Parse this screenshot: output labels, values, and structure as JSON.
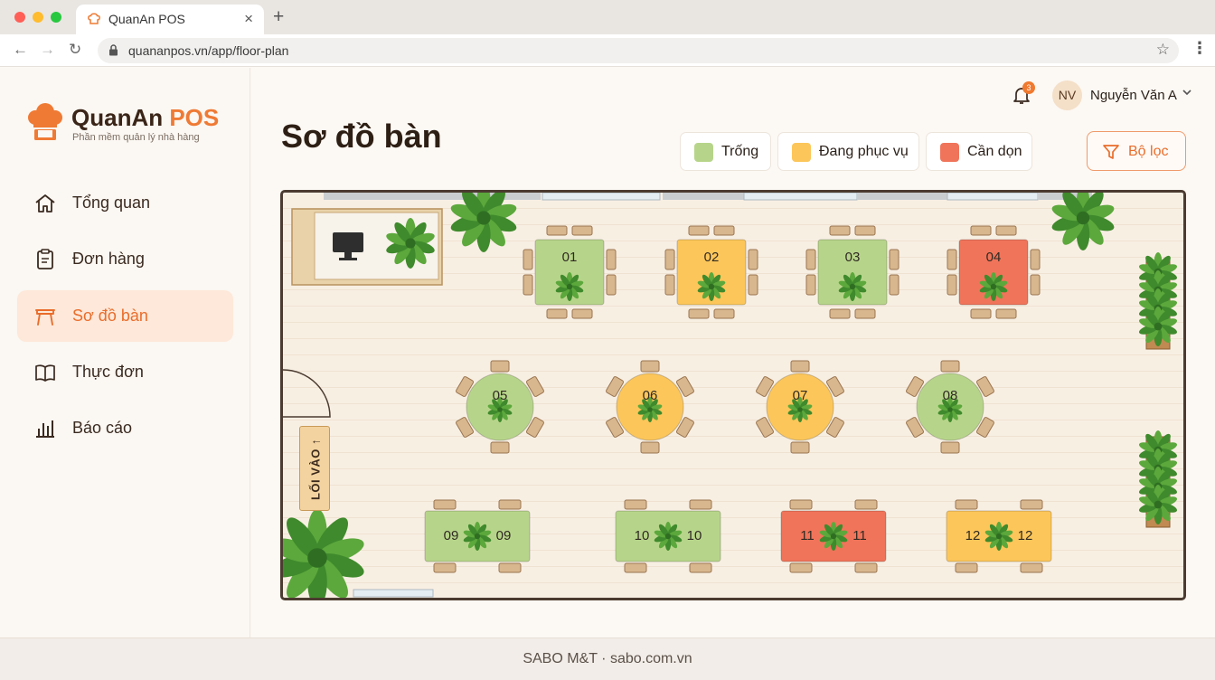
{
  "browser": {
    "tab_title": "QuanAn POS",
    "tab_close": "×",
    "new_tab": "+",
    "url": "quananpos.vn/app/floor-plan",
    "back": "←",
    "forward": "→",
    "reload": "↻",
    "bookmark": "☆",
    "menu": "⋮"
  },
  "brand": {
    "name_main": "QuanAn",
    "name_accent": "POS",
    "tagline": "Phần mềm quản lý nhà hàng",
    "accent_color": "#ef7a34"
  },
  "sidebar": {
    "items": [
      {
        "label": "Tổng quan",
        "icon": "home-icon",
        "active": false
      },
      {
        "label": "Đơn hàng",
        "icon": "clipboard-icon",
        "active": false
      },
      {
        "label": "Sơ đồ bàn",
        "icon": "table-icon",
        "active": true
      },
      {
        "label": "Thực đơn",
        "icon": "book-icon",
        "active": false
      },
      {
        "label": "Báo cáo",
        "icon": "bar-chart-icon",
        "active": false
      }
    ]
  },
  "header": {
    "notification_count": "3",
    "user_initials": "NV",
    "user_name": "Nguyễn Văn A",
    "user_chevron": "⌄"
  },
  "page": {
    "title": "Sơ đồ bàn",
    "legend": [
      {
        "label": "Trống",
        "color": "#b7d58a"
      },
      {
        "label": "Đang phục vụ",
        "color": "#fcc65a"
      },
      {
        "label": "Cần dọn",
        "color": "#f0745a"
      }
    ],
    "filter_label": "Bộ lọc"
  },
  "floor": {
    "entrance_label": "LỐI VÀO ↑",
    "tables": [
      {
        "number": "01",
        "status": "Trống",
        "shape": "square"
      },
      {
        "number": "02",
        "status": "Đang phục vụ",
        "shape": "square"
      },
      {
        "number": "03",
        "status": "Trống",
        "shape": "square"
      },
      {
        "number": "04",
        "status": "Cần dọn",
        "shape": "square"
      },
      {
        "number": "05",
        "status": "Trống",
        "shape": "round"
      },
      {
        "number": "06",
        "status": "Đang phục vụ",
        "shape": "round"
      },
      {
        "number": "07",
        "status": "Đang phục vụ",
        "shape": "round"
      },
      {
        "number": "08",
        "status": "Trống",
        "shape": "round"
      },
      {
        "number": "09",
        "status": "Trống",
        "shape": "rect"
      },
      {
        "number": "10",
        "status": "Trống",
        "shape": "rect"
      },
      {
        "number": "11",
        "status": "Cần dọn",
        "shape": "rect"
      },
      {
        "number": "12",
        "status": "Đang phục vụ",
        "shape": "rect"
      }
    ]
  },
  "footer": {
    "text": "SABO M&T · sabo.com.vn"
  }
}
